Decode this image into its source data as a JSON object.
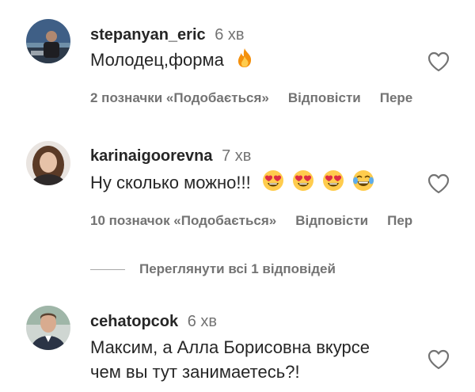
{
  "comments": [
    {
      "username": "stepanyan_eric",
      "time": "6 хв",
      "text": "Молодец,форма",
      "likes": "2 позначки «Подобається»",
      "reply": "Відповісти",
      "translate": "Пере",
      "emojis": [
        "fire"
      ]
    },
    {
      "username": "karinaigoorevna",
      "time": "7 хв",
      "text": "Ну сколько можно!!!",
      "likes": "10 позначок «Подобається»",
      "reply": "Відповісти",
      "translate": "Пер",
      "emojis": [
        "heart-eyes",
        "heart-eyes",
        "heart-eyes",
        "tears-of-joy"
      ]
    },
    {
      "username": "cehatopcok",
      "time": "6 хв",
      "text_line1": "Максим, а Алла Борисовна вкурсе",
      "text_line2": "чем вы тут занимаетесь?!"
    }
  ],
  "view_replies": "Переглянути всі 1 відповідей",
  "icons": {
    "like": "heart-outline-icon"
  },
  "colors": {
    "text": "#262626",
    "secondary": "#737373"
  }
}
